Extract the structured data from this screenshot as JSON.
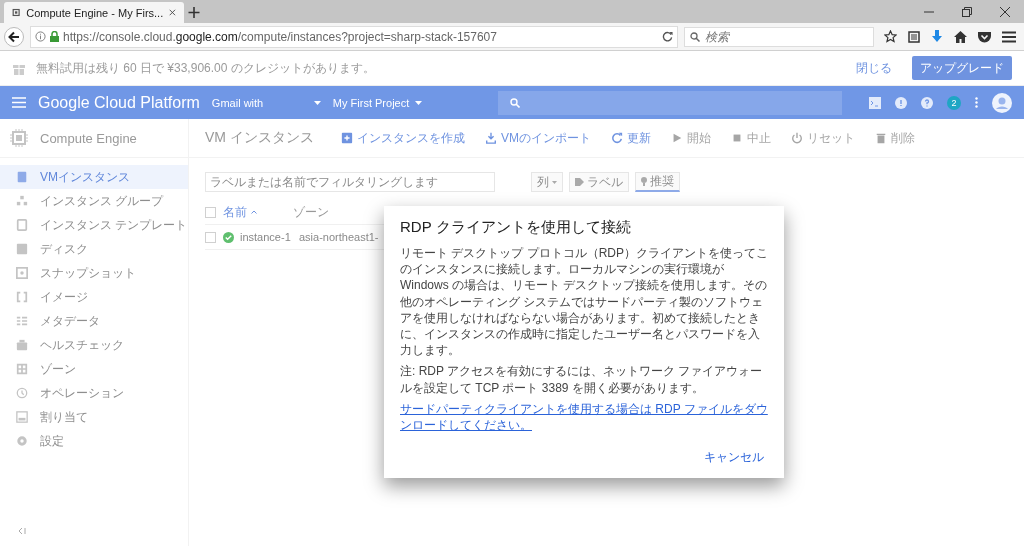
{
  "browser": {
    "tab_title": "Compute Engine - My Firs...",
    "url_host_prefix": "https://console.cloud.",
    "url_host": "google.com",
    "url_path": "/compute/instances?project=sharp-stack-157607",
    "search": {
      "placeholder": "検索"
    }
  },
  "banner": {
    "text": "無料試用は残り 60 日で ¥33,906.00 のクレジットがあります。",
    "dismiss": "閉じる",
    "upgrade": "アップグレード"
  },
  "header": {
    "title": "Google Cloud Platform",
    "account": "Gmail with",
    "project": "My First Project",
    "notifications": "2"
  },
  "sidebar": {
    "title": "Compute Engine",
    "items": [
      {
        "label": "VMインスタンス",
        "kind": "instance",
        "selected": true
      },
      {
        "label": "インスタンス グループ",
        "kind": "group",
        "selected": false
      },
      {
        "label": "インスタンス テンプレート",
        "kind": "template",
        "selected": false
      },
      {
        "label": "ディスク",
        "kind": "disk",
        "selected": false
      },
      {
        "label": "スナップショット",
        "kind": "snapshot",
        "selected": false
      },
      {
        "label": "イメージ",
        "kind": "image",
        "selected": false
      },
      {
        "label": "メタデータ",
        "kind": "metadata",
        "selected": false
      },
      {
        "label": "ヘルスチェック",
        "kind": "health",
        "selected": false
      },
      {
        "label": "ゾーン",
        "kind": "zone",
        "selected": false
      },
      {
        "label": "オペレーション",
        "kind": "clock",
        "selected": false
      },
      {
        "label": "割り当て",
        "kind": "quota",
        "selected": false
      },
      {
        "label": "設定",
        "kind": "gear",
        "selected": false
      }
    ]
  },
  "page": {
    "title": "VM インスタンス",
    "actions": [
      {
        "label": "インスタンスを作成",
        "kind": "add",
        "disabled": false
      },
      {
        "label": "VMのインポート",
        "kind": "import",
        "disabled": false
      },
      {
        "label": "更新",
        "kind": "refresh",
        "disabled": false
      },
      {
        "label": "開始",
        "kind": "play",
        "disabled": true
      },
      {
        "label": "中止",
        "kind": "stop",
        "disabled": true
      },
      {
        "label": "リセット",
        "kind": "power",
        "disabled": true
      },
      {
        "label": "削除",
        "kind": "trash",
        "disabled": true
      }
    ]
  },
  "filter": {
    "placeholder": "ラベルまたは名前でフィルタリングします",
    "columns": "列",
    "labels": "ラベル",
    "recommend": "推奨"
  },
  "table": {
    "all_checked": false,
    "columns": [
      "名前",
      "ゾーン"
    ],
    "rows": [
      {
        "name": "instance-1",
        "zone": "asia-northeast1-",
        "checked": false
      }
    ]
  },
  "dialog": {
    "title": "RDP クライアントを使用して接続",
    "body": "リモート デスクトップ プロトコル（RDP）クライアントを使ってこのインスタンスに接続します。ローカルマシンの実行環境が Windows の場合は、リモート デスクトップ接続を使用します。その他のオペレーティング システムではサードパーティ製のソフトウェアを使用しなければならない場合があります。初めて接続したときに、インスタンスの作成時に指定したユーザー名とパスワードを入力します。",
    "note": "注: RDP アクセスを有効にするには、ネットワーク ファイアウォールを設定して TCP ポート 3389 を開く必要があります。",
    "link": "サードパーティクライアントを使用する場合は RDP ファイルをダウンロードしてください。",
    "cancel": "キャンセル"
  }
}
